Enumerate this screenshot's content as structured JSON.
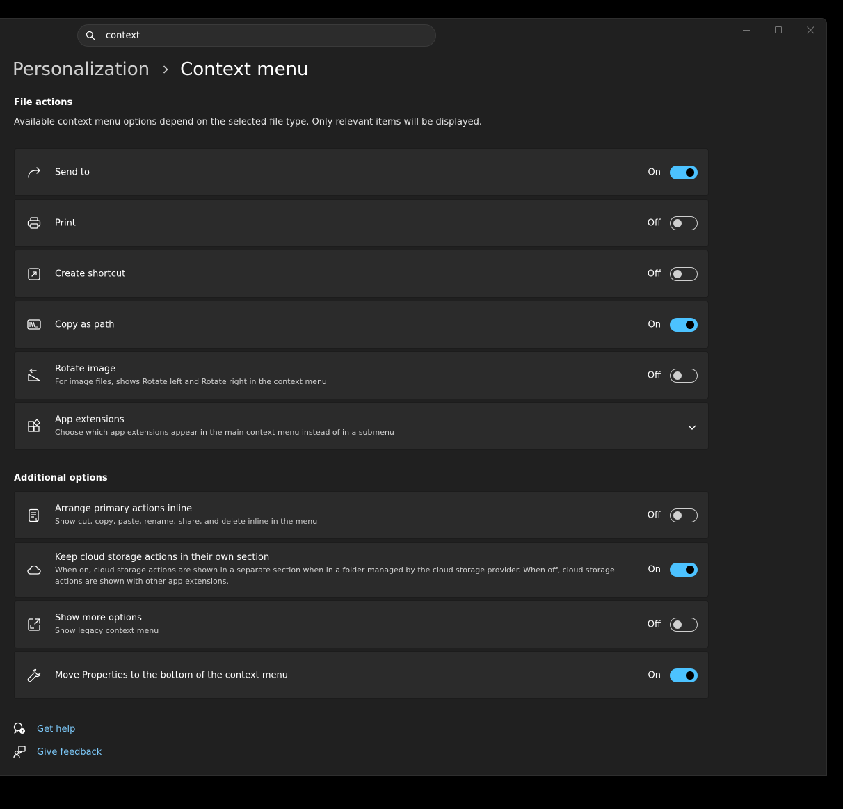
{
  "search": {
    "value": "context"
  },
  "breadcrumb": {
    "parent": "Personalization",
    "current": "Context menu"
  },
  "file_actions": {
    "title": "File actions",
    "description": "Available context menu options depend on the selected file type. Only relevant items will be displayed.",
    "items": [
      {
        "icon": "share-arrow-icon",
        "title": "Send to",
        "state": "On"
      },
      {
        "icon": "printer-icon",
        "title": "Print",
        "state": "Off"
      },
      {
        "icon": "shortcut-icon",
        "title": "Create shortcut",
        "state": "Off"
      },
      {
        "icon": "copy-path-icon",
        "title": "Copy as path",
        "state": "On"
      },
      {
        "icon": "rotate-image-icon",
        "title": "Rotate image",
        "subtitle": "For image files, shows Rotate left and Rotate right in the context menu",
        "state": "Off"
      },
      {
        "icon": "app-extensions-icon",
        "title": "App extensions",
        "subtitle": "Choose which app extensions appear in the main context menu instead of in a submenu"
      }
    ]
  },
  "additional_options": {
    "title": "Additional options",
    "items": [
      {
        "icon": "document-inline-icon",
        "title": "Arrange primary actions inline",
        "subtitle": "Show cut, copy, paste, rename, share, and delete inline in the menu",
        "state": "Off"
      },
      {
        "icon": "cloud-icon",
        "title": "Keep cloud storage actions in their own section",
        "subtitle": "When on, cloud storage actions are shown in a separate section when in a folder managed by the cloud storage provider. When off, cloud storage actions are shown with other app extensions.",
        "state": "On"
      },
      {
        "icon": "open-in-window-icon",
        "title": "Show more options",
        "subtitle": "Show legacy context menu",
        "state": "Off"
      },
      {
        "icon": "wrench-icon",
        "title": "Move Properties to the bottom of the context menu",
        "state": "On"
      }
    ]
  },
  "footer": {
    "help": "Get help",
    "feedback": "Give feedback"
  },
  "colors": {
    "accent": "#4cc2ff",
    "link": "#7cc8f8",
    "card": "#2b2b2b",
    "window": "#202020"
  }
}
